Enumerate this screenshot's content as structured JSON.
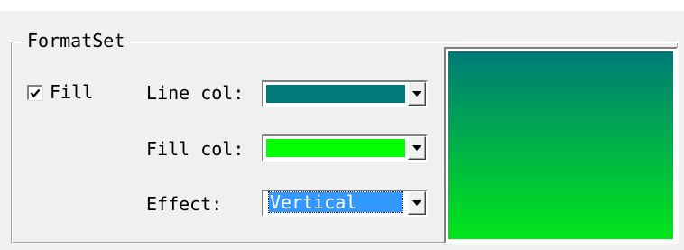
{
  "formatset": {
    "title": "FormatSet",
    "fill": {
      "label": "Fill",
      "checked": true
    },
    "line_color": {
      "label": "Line col:",
      "value": "#007a78"
    },
    "fill_color": {
      "label": "Fill col:",
      "value": "#00ff00"
    },
    "effect": {
      "label": "Effect:",
      "selected": "Vertical"
    },
    "preview": {
      "top_color": "#007a78",
      "bottom_color": "#00e61a"
    }
  }
}
